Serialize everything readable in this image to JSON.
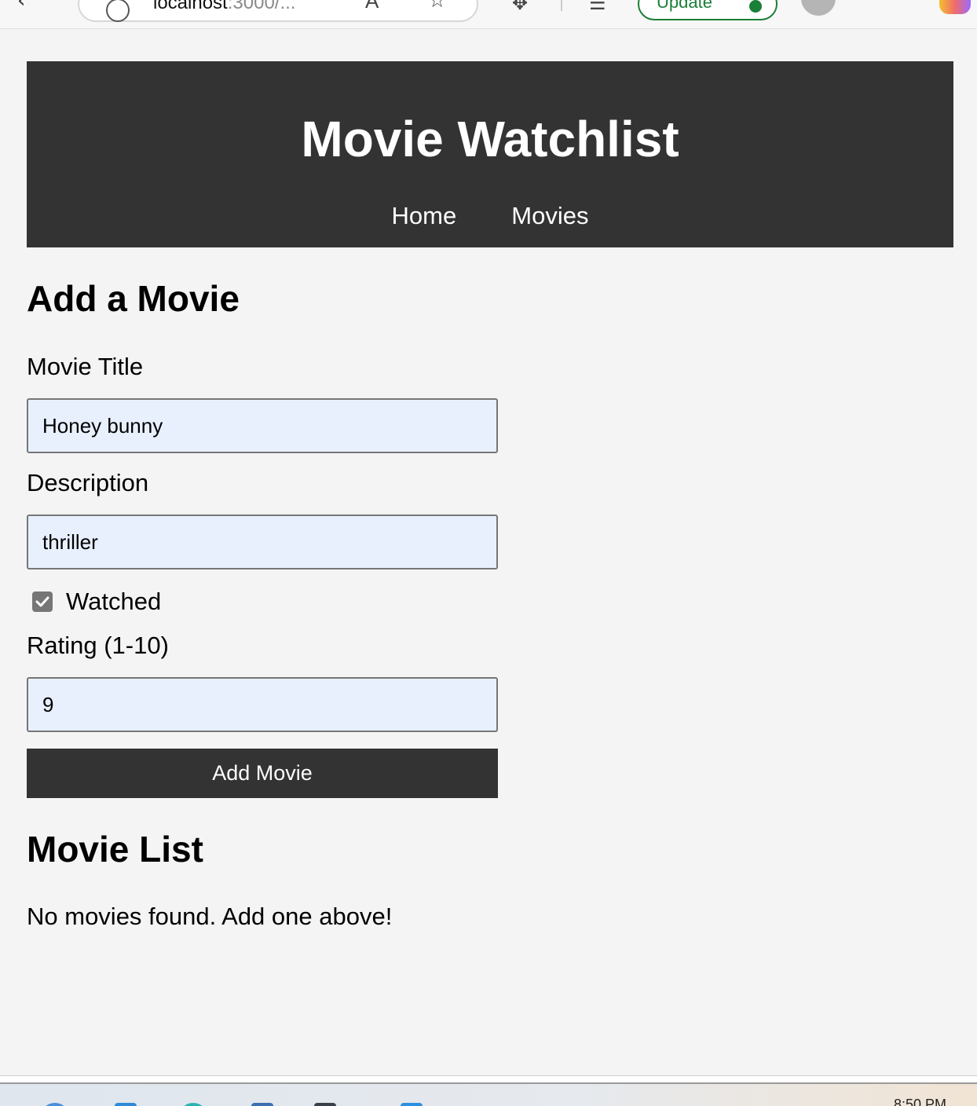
{
  "browser": {
    "address_host": "localhost",
    "address_rest": ":3000/...",
    "update_label": "Update",
    "clock": "8:50 PM"
  },
  "header": {
    "title": "Movie Watchlist",
    "nav": [
      "Home",
      "Movies"
    ]
  },
  "form": {
    "heading": "Add a Movie",
    "title_label": "Movie Title",
    "title_value": "Honey bunny",
    "description_label": "Description",
    "description_value": "thriller",
    "watched_label": "Watched",
    "watched_checked": true,
    "rating_label": "Rating (1-10)",
    "rating_value": "9",
    "submit_label": "Add Movie"
  },
  "list": {
    "heading": "Movie List",
    "empty_message": "No movies found. Add one above!"
  },
  "colors": {
    "header_bg": "#333333",
    "page_bg": "#f4f4f4",
    "input_bg": "#e8f0fe",
    "update_green": "#1a7f37"
  }
}
